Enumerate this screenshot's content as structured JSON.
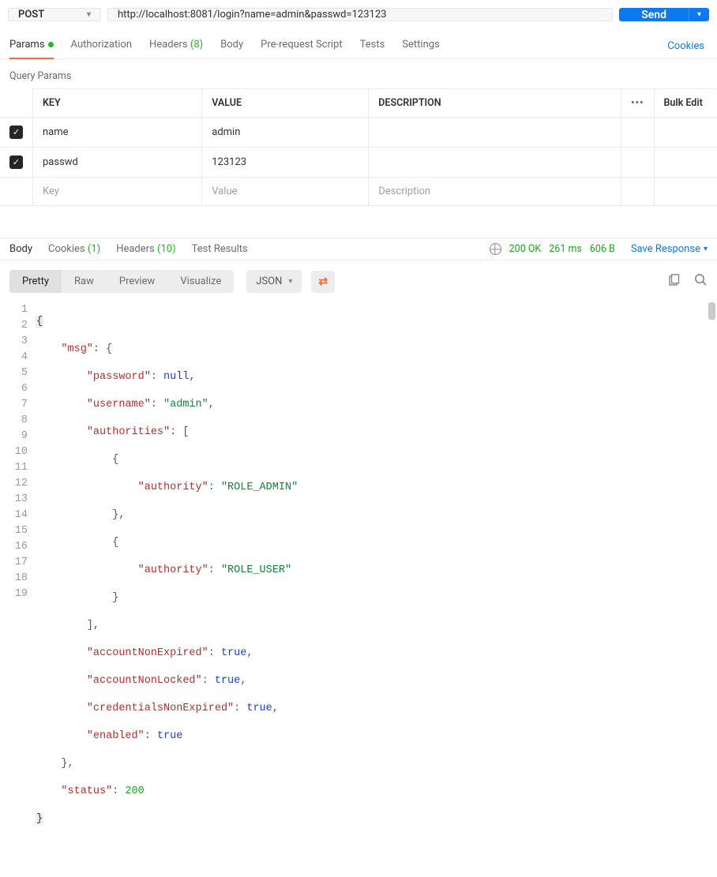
{
  "request": {
    "method": "POST",
    "url": "http://localhost:8081/login?name=admin&passwd=123123",
    "send_label": "Send"
  },
  "req_tabs": {
    "params": "Params",
    "authorization": "Authorization",
    "headers": "Headers",
    "headers_count": "(8)",
    "body": "Body",
    "prerequest": "Pre-request Script",
    "tests": "Tests",
    "settings": "Settings",
    "cookies": "Cookies"
  },
  "query_params": {
    "title": "Query Params",
    "col_key": "KEY",
    "col_value": "VALUE",
    "col_desc": "DESCRIPTION",
    "bulk": "Bulk Edit",
    "rows": [
      {
        "checked": true,
        "key": "name",
        "value": "admin",
        "desc": ""
      },
      {
        "checked": true,
        "key": "passwd",
        "value": "123123",
        "desc": ""
      }
    ],
    "ph_key": "Key",
    "ph_value": "Value",
    "ph_desc": "Description"
  },
  "response": {
    "tabs": {
      "body": "Body",
      "cookies": "Cookies",
      "cookies_count": "(1)",
      "headers": "Headers",
      "headers_count": "(10)",
      "results": "Test Results"
    },
    "status": "200 OK",
    "time": "261 ms",
    "size": "606 B",
    "save": "Save Response"
  },
  "view": {
    "seg": {
      "pretty": "Pretty",
      "raw": "Raw",
      "preview": "Preview",
      "visualize": "Visualize"
    },
    "format": "JSON"
  },
  "code": {
    "l2_k": "\"msg\"",
    "l3_k": "\"password\"",
    "l4_k": "\"username\"",
    "l4_v": "\"admin\"",
    "l5_k": "\"authorities\"",
    "l7_k": "\"authority\"",
    "l7_v": "\"ROLE_ADMIN\"",
    "l10_k": "\"authority\"",
    "l10_v": "\"ROLE_USER\"",
    "l13_k": "\"accountNonExpired\"",
    "l14_k": "\"accountNonLocked\"",
    "l15_k": "\"credentialsNonExpired\"",
    "l16_k": "\"enabled\"",
    "l18_k": "\"status\"",
    "l18_v": "200",
    "null": "null",
    "true": "true"
  }
}
